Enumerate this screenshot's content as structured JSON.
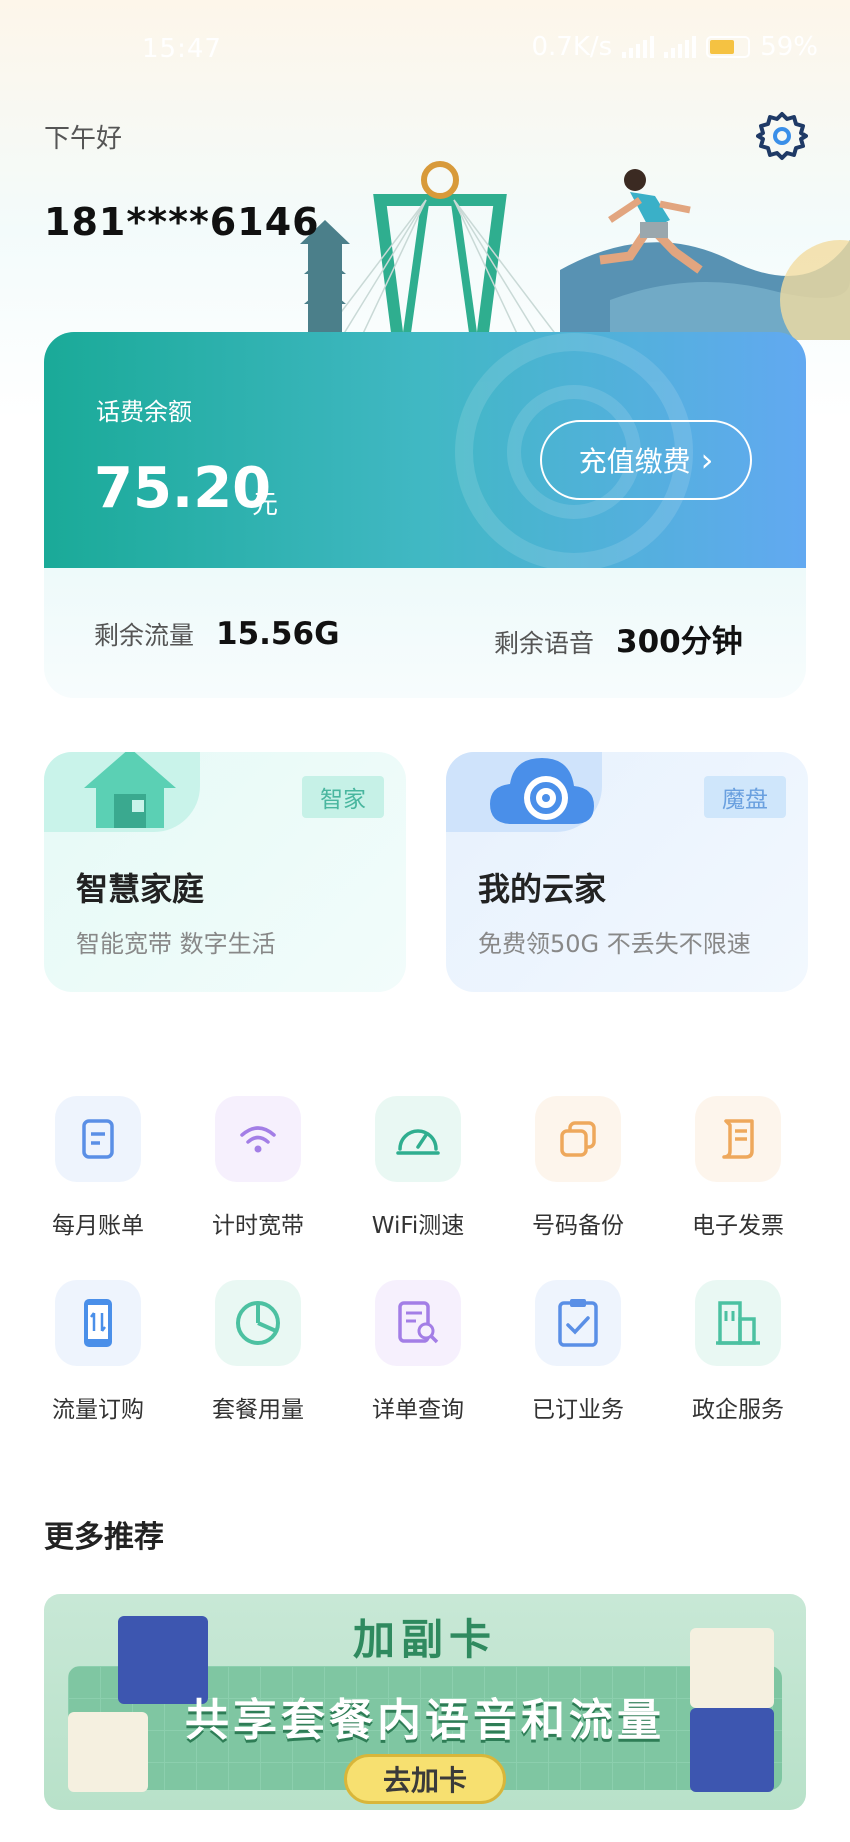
{
  "status_bar": {
    "time": "15:47",
    "net_speed": "0.7K/s",
    "battery": "59%"
  },
  "header": {
    "greeting": "下午好",
    "phone_masked": "181****6146"
  },
  "balance": {
    "label": "话费余额",
    "amount": "75.20",
    "unit": "元",
    "recharge_label": "充值缴费",
    "recharge_chevron": "›"
  },
  "usage": {
    "data_label": "剩余流量",
    "data_value": "15.56G",
    "voice_label": "剩余语音",
    "voice_value": "300分钟"
  },
  "features": [
    {
      "tag": "智家",
      "title": "智慧家庭",
      "subtitle": "智能宽带  数字生活",
      "icon": "house-icon"
    },
    {
      "tag": "魔盘",
      "title": "我的云家",
      "subtitle": "免费领50G 不丢失不限速",
      "icon": "cloud-disk-icon"
    }
  ],
  "services": [
    {
      "label": "每月账单",
      "icon": "bill-icon"
    },
    {
      "label": "计时宽带",
      "icon": "wifi-icon"
    },
    {
      "label": "WiFi测速",
      "icon": "speedometer-icon"
    },
    {
      "label": "号码备份",
      "icon": "copy-icon"
    },
    {
      "label": "电子发票",
      "icon": "invoice-icon"
    },
    {
      "label": "流量订购",
      "icon": "phone-data-icon"
    },
    {
      "label": "套餐用量",
      "icon": "pie-chart-icon"
    },
    {
      "label": "详单查询",
      "icon": "document-search-icon"
    },
    {
      "label": "已订业务",
      "icon": "clipboard-check-icon"
    },
    {
      "label": "政企服务",
      "icon": "building-icon"
    }
  ],
  "more": {
    "title": "更多推荐"
  },
  "banner": {
    "title": "加副卡",
    "subtitle": "共享套餐内语音和流量",
    "cta": "去加卡"
  },
  "colors": {
    "card_gradient_start": "#1aaa98",
    "card_gradient_end": "#62a9f1",
    "settings_icon": "#1f3a66",
    "banner_green": "#7fc6a2"
  }
}
